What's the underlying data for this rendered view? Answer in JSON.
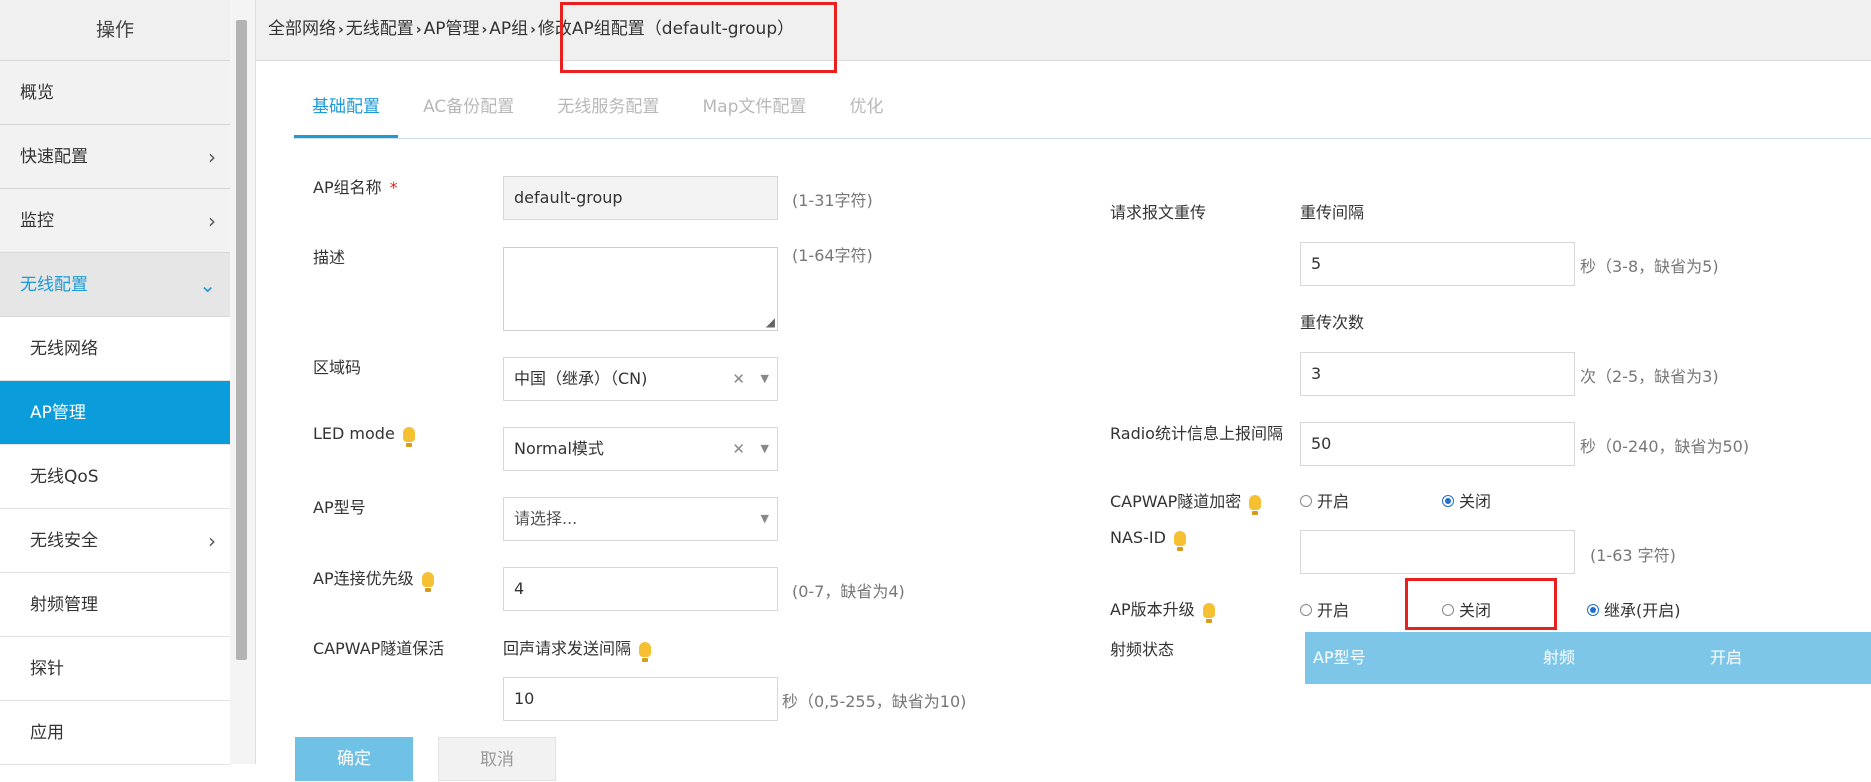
{
  "sidebar": {
    "header": "操作",
    "items": [
      {
        "label": "概览"
      },
      {
        "label": "快速配置"
      },
      {
        "label": "监控"
      },
      {
        "label": "无线配置"
      },
      {
        "label": "无线网络"
      },
      {
        "label": "AP管理"
      },
      {
        "label": "无线QoS"
      },
      {
        "label": "无线安全"
      },
      {
        "label": "射频管理"
      },
      {
        "label": "探针"
      },
      {
        "label": "应用"
      }
    ]
  },
  "breadcrumb": {
    "items": [
      "全部网络",
      "无线配置",
      "AP管理",
      "AP组",
      "修改AP组配置（default-group）"
    ]
  },
  "tabs": [
    "基础配置",
    "AC备份配置",
    "无线服务配置",
    "Map文件配置",
    "优化"
  ],
  "form_left": {
    "group_name": {
      "label": "AP组名称",
      "required": "*",
      "value": "default-group",
      "hint": "(1-31字符)"
    },
    "description": {
      "label": "描述",
      "value": "",
      "hint": "(1-64字符)"
    },
    "region_code": {
      "label": "区域码",
      "value": "中国（继承）（CN)"
    },
    "led_mode": {
      "label": "LED mode",
      "value": "Normal模式"
    },
    "ap_model": {
      "label": "AP型号",
      "placeholder": "请选择..."
    },
    "priority": {
      "label": "AP连接优先级",
      "value": "4",
      "hint": "(0-7，缺省为4)"
    },
    "capwap_keepalive": {
      "label": "CAPWAP隧道保活",
      "sub_label": "回声请求发送间隔",
      "value": "10",
      "hint": "秒（0,5-255，缺省为10)"
    }
  },
  "form_right": {
    "retransmit": {
      "label": "请求报文重传",
      "interval_label": "重传间隔",
      "interval_value": "5",
      "interval_hint": "秒（3-8，缺省为5)",
      "count_label": "重传次数",
      "count_value": "3",
      "count_hint": "次（2-5，缺省为3)"
    },
    "radio_stats": {
      "label": "Radio统计信息上报间隔",
      "value": "50",
      "hint": "秒（0-240，缺省为50)"
    },
    "capwap_encrypt": {
      "label": "CAPWAP隧道加密",
      "options": [
        "开启",
        "关闭"
      ],
      "selected": "关闭"
    },
    "nas_id": {
      "label": "NAS-ID",
      "value": "",
      "hint": "(1-63 字符)"
    },
    "ap_upgrade": {
      "label": "AP版本升级",
      "options": [
        "开启",
        "关闭",
        "继承(开启)"
      ],
      "selected": "继承(开启)"
    },
    "radio_status": {
      "label": "射频状态",
      "columns": [
        "AP型号",
        "射频",
        "开启"
      ]
    }
  },
  "buttons": {
    "ok": "确定",
    "cancel": "取消"
  },
  "colors": {
    "accent": "#1e9ad6",
    "highlight_box": "#e8201e",
    "table_header": "#7ec6e8"
  }
}
